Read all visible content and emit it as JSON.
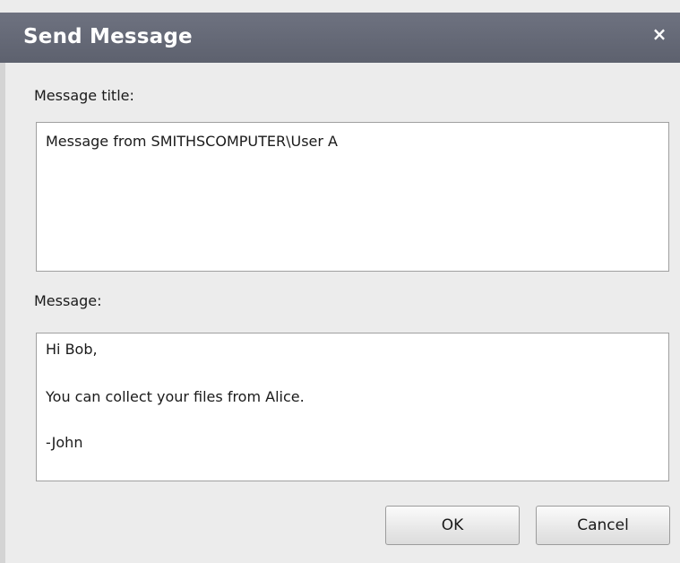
{
  "dialog": {
    "title": "Send Message",
    "close_glyph": "×"
  },
  "form": {
    "title_label": "Message title:",
    "title_value": "Message from SMITHSCOMPUTER\\User A",
    "message_label": "Message:",
    "message_lines": [
      "Hi Bob,",
      "You can collect your files from Alice.",
      "-John"
    ]
  },
  "buttons": {
    "ok_label": "OK",
    "cancel_label": "Cancel"
  },
  "colors": {
    "title_bar": "#62666f",
    "dialog_background": "#ececec",
    "title_text": "#ffffff"
  },
  "icons": {
    "close": "close-icon"
  }
}
